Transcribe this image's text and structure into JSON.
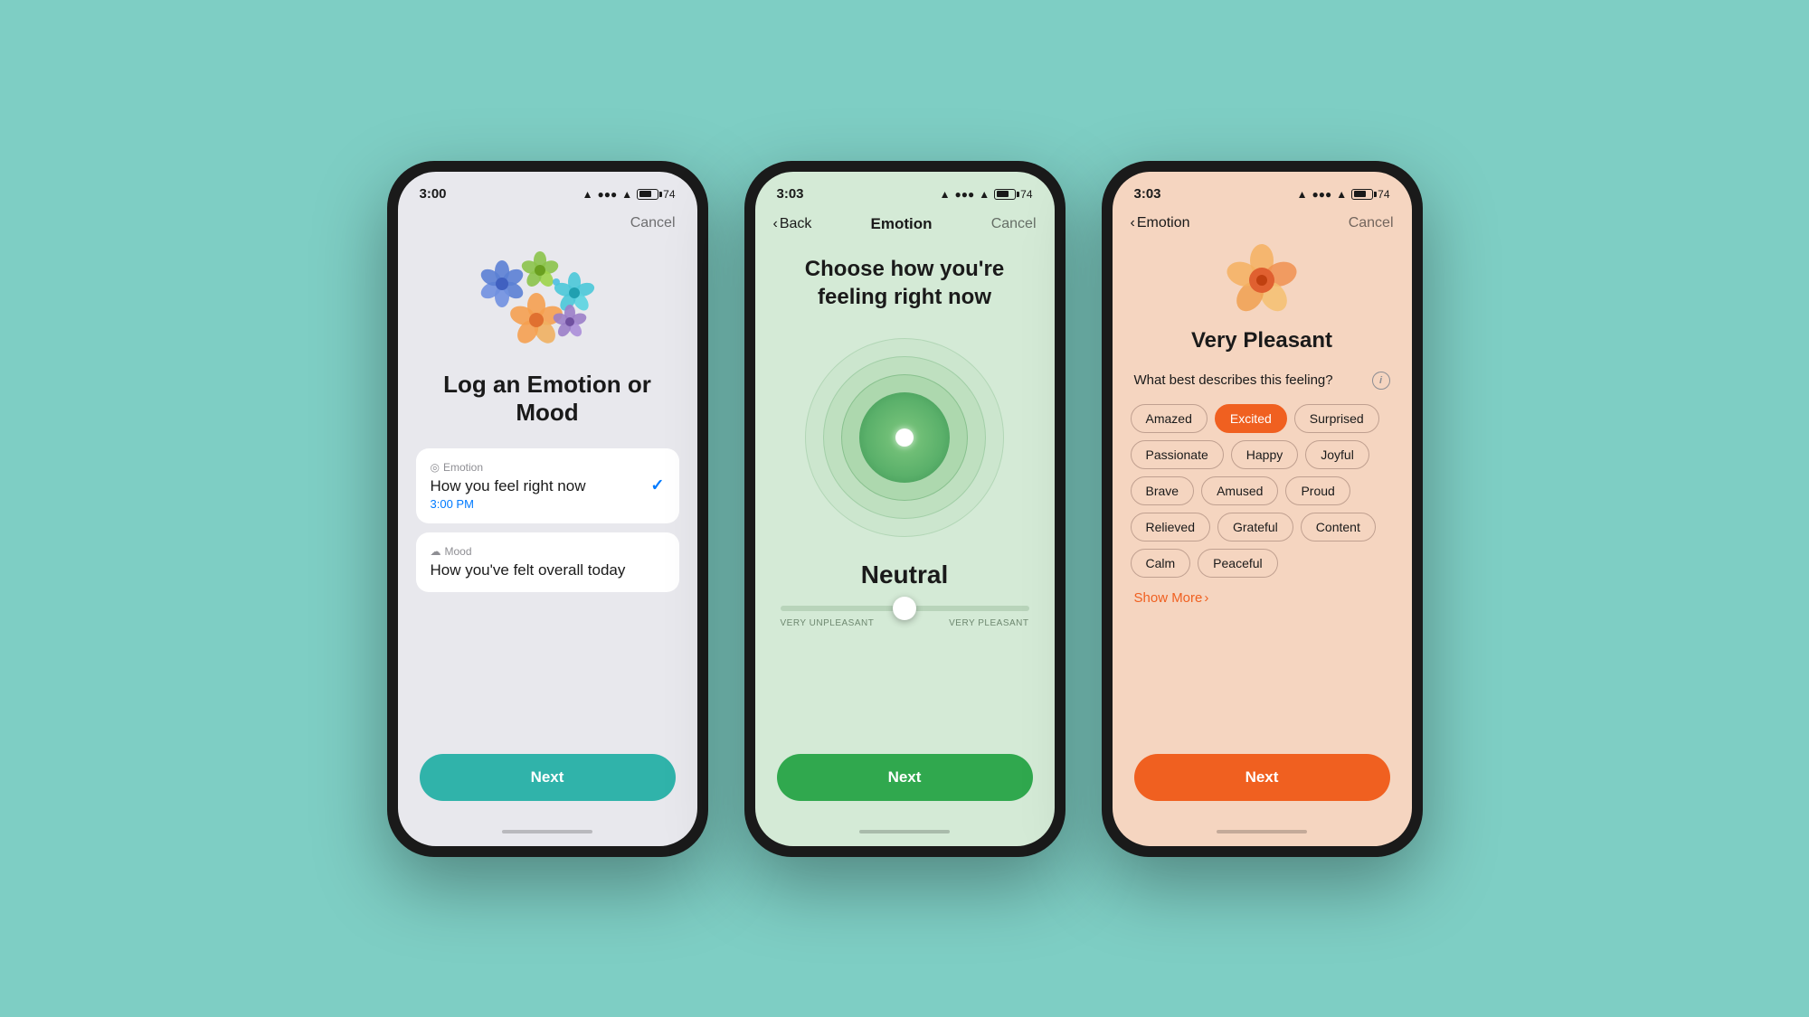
{
  "background_color": "#7ecec4",
  "phone1": {
    "status": {
      "time": "3:00",
      "location": true,
      "signal": "●●●",
      "wifi": "wifi",
      "battery": "74"
    },
    "nav": {
      "cancel": "Cancel"
    },
    "title": "Log an Emotion\nor Mood",
    "options": [
      {
        "icon": "emotion-icon",
        "label": "Emotion",
        "description": "How you feel right now",
        "time": "3:00 PM",
        "selected": true
      },
      {
        "icon": "mood-icon",
        "label": "Mood",
        "description": "How you've felt overall today",
        "time": null,
        "selected": false
      }
    ],
    "next_label": "Next"
  },
  "phone2": {
    "status": {
      "time": "3:03",
      "location": true,
      "battery": "74"
    },
    "nav": {
      "back": "Back",
      "title": "Emotion",
      "cancel": "Cancel"
    },
    "heading": "Choose how you're feeling\nright now",
    "current_emotion": "Neutral",
    "slider": {
      "min_label": "VERY UNPLEASANT",
      "max_label": "VERY PLEASANT",
      "value": 50
    },
    "next_label": "Next"
  },
  "phone3": {
    "status": {
      "time": "3:03",
      "location": true,
      "battery": "74"
    },
    "nav": {
      "back": "Emotion",
      "cancel": "Cancel"
    },
    "emotion_level": "Very Pleasant",
    "describe_label": "What best describes this feeling?",
    "tags": [
      {
        "label": "Amazed",
        "selected": false
      },
      {
        "label": "Excited",
        "selected": true
      },
      {
        "label": "Surprised",
        "selected": false
      },
      {
        "label": "Passionate",
        "selected": false
      },
      {
        "label": "Happy",
        "selected": false
      },
      {
        "label": "Joyful",
        "selected": false
      },
      {
        "label": "Brave",
        "selected": false
      },
      {
        "label": "Amused",
        "selected": false
      },
      {
        "label": "Proud",
        "selected": false
      },
      {
        "label": "Relieved",
        "selected": false
      },
      {
        "label": "Grateful",
        "selected": false
      },
      {
        "label": "Content",
        "selected": false
      },
      {
        "label": "Calm",
        "selected": false
      },
      {
        "label": "Peaceful",
        "selected": false
      }
    ],
    "show_more": "Show More",
    "next_label": "Next"
  }
}
